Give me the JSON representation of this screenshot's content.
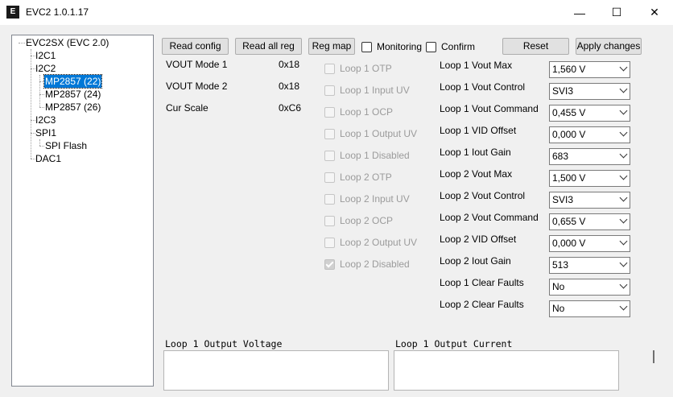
{
  "window": {
    "title": "EVC2 1.0.1.17",
    "icon_name": "app-logo-icon",
    "minimize_glyph": "—",
    "maximize_glyph": "☐",
    "close_glyph": "✕"
  },
  "tree": {
    "root": "EVC2SX (EVC 2.0)",
    "i2c1": "I2C1",
    "i2c2": "I2C2",
    "mp2857_22": "MP2857 (22)",
    "mp2857_24": "MP2857 (24)",
    "mp2857_26": "MP2857 (26)",
    "i2c3": "I2C3",
    "spi1": "SPI1",
    "spi_flash": "SPI Flash",
    "dac1": "DAC1",
    "selected": "MP2857 (22)"
  },
  "toolbar": {
    "read_config": "Read config",
    "read_all_reg": "Read all reg",
    "reg_map": "Reg map",
    "monitoring": "Monitoring",
    "confirm": "Confirm",
    "reset": "Reset",
    "apply_changes": "Apply changes"
  },
  "registers": [
    {
      "label": "VOUT Mode 1",
      "value": "0x18"
    },
    {
      "label": "VOUT Mode 2",
      "value": "0x18"
    },
    {
      "label": "Cur Scale",
      "value": "0xC6"
    }
  ],
  "status_flags": [
    {
      "label": "Loop 1 OTP",
      "checked": false
    },
    {
      "label": "Loop 1 Input UV",
      "checked": false
    },
    {
      "label": "Loop 1 OCP",
      "checked": false
    },
    {
      "label": "Loop 1 Output UV",
      "checked": false
    },
    {
      "label": "Loop 1 Disabled",
      "checked": false
    },
    {
      "label": "Loop 2 OTP",
      "checked": false
    },
    {
      "label": "Loop 2 Input UV",
      "checked": false
    },
    {
      "label": "Loop 2 OCP",
      "checked": false
    },
    {
      "label": "Loop 2 Output UV",
      "checked": false
    },
    {
      "label": "Loop 2 Disabled",
      "checked": true
    }
  ],
  "params": [
    {
      "label": "Loop 1 Vout Max",
      "value": "1,560 V"
    },
    {
      "label": "Loop 1 Vout Control",
      "value": "SVI3"
    },
    {
      "label": "Loop 1 Vout Command",
      "value": "0,455 V"
    },
    {
      "label": "Loop 1 VID Offset",
      "value": "0,000 V"
    },
    {
      "label": "Loop 1 Iout Gain",
      "value": "683"
    },
    {
      "label": "Loop 2 Vout Max",
      "value": "1,500 V"
    },
    {
      "label": "Loop 2 Vout Control",
      "value": "SVI3"
    },
    {
      "label": "Loop 2 Vout Command",
      "value": "0,655 V"
    },
    {
      "label": "Loop 2 VID Offset",
      "value": "0,000 V"
    },
    {
      "label": "Loop 2 Iout Gain",
      "value": "513"
    },
    {
      "label": "Loop 1 Clear Faults",
      "value": "No"
    },
    {
      "label": "Loop 2 Clear Faults",
      "value": "No"
    }
  ],
  "plots": {
    "left_title": "Loop 1 Output Voltage",
    "right_title": "Loop 1 Output Current"
  }
}
